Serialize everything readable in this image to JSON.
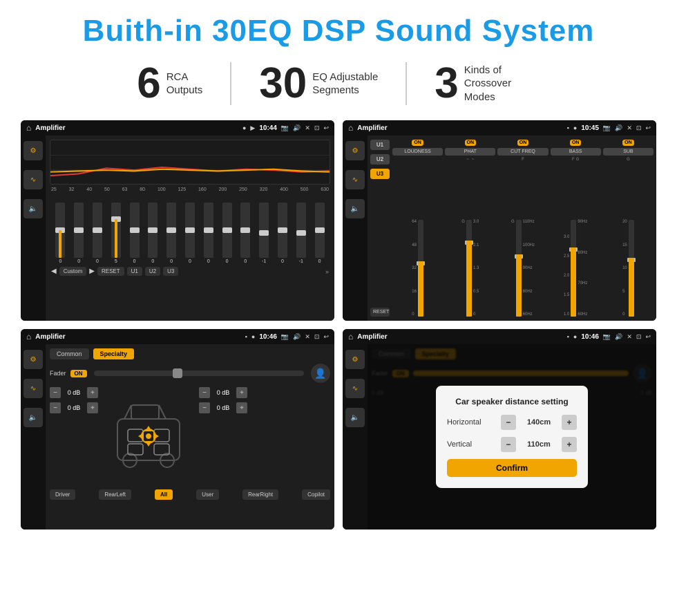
{
  "page": {
    "title": "Buith-in 30EQ DSP Sound System",
    "stats": [
      {
        "number": "6",
        "label_line1": "RCA",
        "label_line2": "Outputs"
      },
      {
        "number": "30",
        "label_line1": "EQ Adjustable",
        "label_line2": "Segments"
      },
      {
        "number": "3",
        "label_line1": "Kinds of",
        "label_line2": "Crossover Modes"
      }
    ]
  },
  "screen1": {
    "status": {
      "title": "Amplifier",
      "time": "10:44"
    },
    "eq_freqs": [
      "25",
      "32",
      "40",
      "50",
      "63",
      "80",
      "100",
      "125",
      "160",
      "200",
      "250",
      "320",
      "400",
      "500",
      "630"
    ],
    "eq_values": [
      "0",
      "0",
      "0",
      "5",
      "0",
      "0",
      "0",
      "0",
      "0",
      "0",
      "0",
      "-1",
      "0",
      "-1"
    ],
    "preset": "Custom",
    "buttons": [
      "RESET",
      "U1",
      "U2",
      "U3"
    ]
  },
  "screen2": {
    "status": {
      "title": "Amplifier",
      "time": "10:45"
    },
    "presets": [
      "U1",
      "U2",
      "U3"
    ],
    "channels": [
      {
        "name": "LOUDNESS",
        "on": true
      },
      {
        "name": "PHAT",
        "on": true
      },
      {
        "name": "CUT FREQ",
        "on": true
      },
      {
        "name": "BASS",
        "on": true
      },
      {
        "name": "SUB",
        "on": true
      }
    ],
    "reset_label": "RESET"
  },
  "screen3": {
    "status": {
      "title": "Amplifier",
      "time": "10:46"
    },
    "tabs": [
      "Common",
      "Specialty"
    ],
    "fader_label": "Fader",
    "fader_on": "ON",
    "db_rows": [
      {
        "value": "0 dB"
      },
      {
        "value": "0 dB"
      },
      {
        "value": "0 dB"
      },
      {
        "value": "0 dB"
      }
    ],
    "bottom_btns": [
      "Driver",
      "RearLeft",
      "All",
      "User",
      "RearRight",
      "Copilot"
    ]
  },
  "screen4": {
    "status": {
      "title": "Amplifier",
      "time": "10:46"
    },
    "tabs": [
      "Common",
      "Specialty"
    ],
    "dialog": {
      "title": "Car speaker distance setting",
      "horizontal_label": "Horizontal",
      "horizontal_value": "140cm",
      "vertical_label": "Vertical",
      "vertical_value": "110cm",
      "confirm_label": "Confirm"
    },
    "db_rows": [
      {
        "value": "0 dB"
      },
      {
        "value": "0 dB"
      }
    ],
    "bottom_btns": [
      "Driver",
      "RearLeft",
      "All",
      "User",
      "RearRight",
      "Copilot"
    ]
  },
  "icons": {
    "home": "⌂",
    "menu_dots": "⋮",
    "circle": "●",
    "pin": "📍",
    "camera": "📷",
    "volume": "🔊",
    "x": "✕",
    "window": "⊡",
    "back": "↩",
    "eq": "≡",
    "waveform": "∿",
    "speaker": "🔈",
    "plus": "+",
    "minus": "−",
    "left_arrow": "◀",
    "right_arrow": "▶",
    "up_arrow": "▲",
    "down_arrow": "▼",
    "person": "👤",
    "double_right": "»"
  }
}
